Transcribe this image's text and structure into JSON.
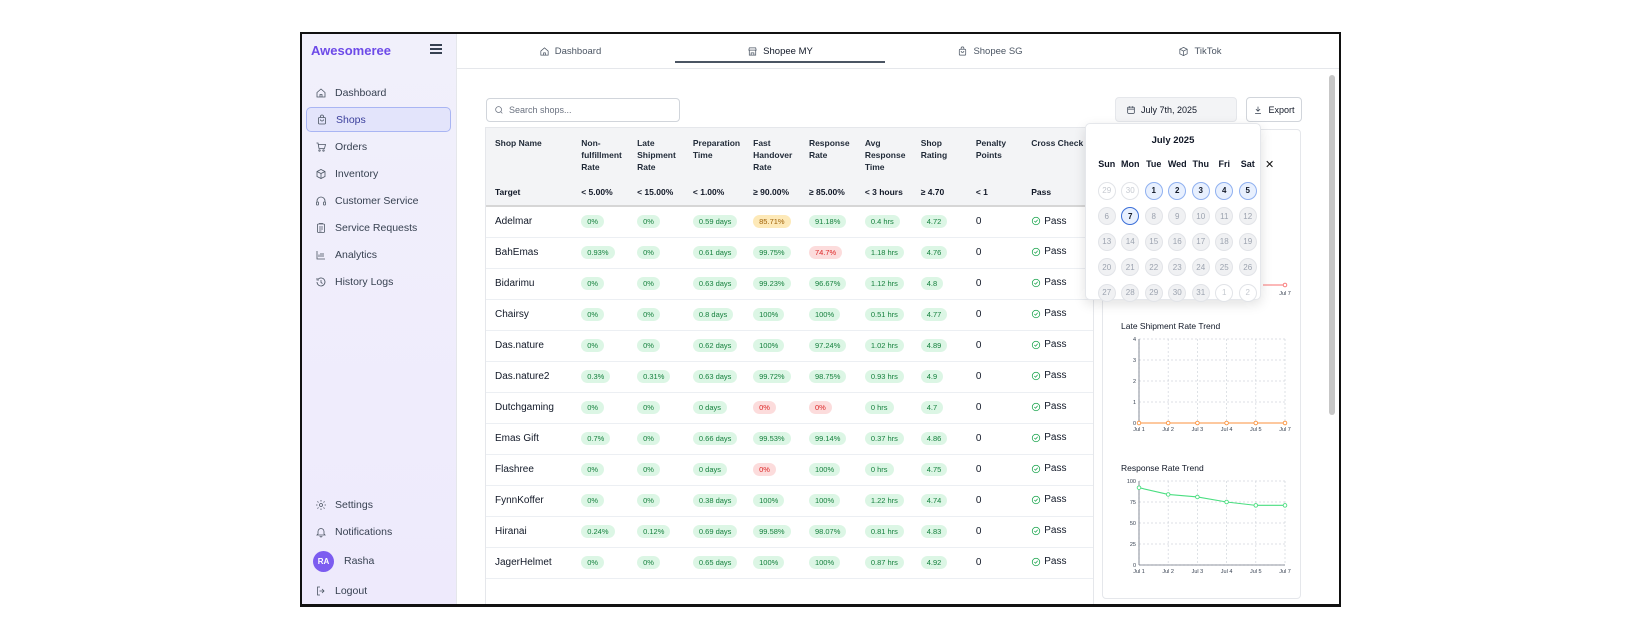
{
  "app": {
    "brand": "Awesomeree"
  },
  "sidebar": {
    "items": [
      {
        "label": "Dashboard",
        "icon": "home-icon"
      },
      {
        "label": "Shops",
        "icon": "shopping-bag-icon",
        "active": true
      },
      {
        "label": "Orders",
        "icon": "cart-icon"
      },
      {
        "label": "Inventory",
        "icon": "box-icon"
      },
      {
        "label": "Customer Service",
        "icon": "headset-icon"
      },
      {
        "label": "Service Requests",
        "icon": "clipboard-icon"
      },
      {
        "label": "Analytics",
        "icon": "bar-chart-icon"
      },
      {
        "label": "History Logs",
        "icon": "history-icon"
      }
    ],
    "bottom": {
      "settings": "Settings",
      "notifications": "Notifications",
      "user_initials": "RA",
      "user_name": "Rasha",
      "logout": "Logout"
    }
  },
  "tabs": [
    {
      "label": "Dashboard",
      "icon": "home-icon"
    },
    {
      "label": "Shopee MY",
      "icon": "store-icon",
      "active": true
    },
    {
      "label": "Shopee SG",
      "icon": "shopping-bag-icon"
    },
    {
      "label": "TikTok",
      "icon": "box-icon"
    }
  ],
  "toolbar": {
    "search_placeholder": "Search shops...",
    "date": "July 7th, 2025",
    "export": "Export"
  },
  "table": {
    "headers": [
      "Shop Name",
      "Non-fulfillment Rate",
      "Late Shipment Rate",
      "Preparation Time",
      "Fast Handover Rate",
      "Response Rate",
      "Avg Response Time",
      "Shop Rating",
      "Penalty Points",
      "Cross Check"
    ],
    "target": [
      "Target",
      "< 5.00%",
      "< 15.00%",
      "< 1.00%",
      "≥ 90.00%",
      "≥ 85.00%",
      "< 3 hours",
      "≥ 4.70",
      "< 1",
      "Pass"
    ],
    "rows": [
      {
        "shop": "Adelmar",
        "nfr": "0%",
        "lsr": "0%",
        "prep": "0.59 days",
        "fhr": "85.71%",
        "rr": "91.18%",
        "art": "0.4 hrs",
        "rating": "4.72",
        "pen": "0",
        "cc": "Pass",
        "fhr_status": "warn"
      },
      {
        "shop": "BahEmas",
        "nfr": "0.93%",
        "lsr": "0%",
        "prep": "0.61 days",
        "fhr": "99.75%",
        "rr": "74.7%",
        "art": "1.18 hrs",
        "rating": "4.76",
        "pen": "0",
        "cc": "Pass",
        "rr_status": "bad"
      },
      {
        "shop": "Bidarimu",
        "nfr": "0%",
        "lsr": "0%",
        "prep": "0.63 days",
        "fhr": "99.23%",
        "rr": "96.67%",
        "art": "1.12 hrs",
        "rating": "4.8",
        "pen": "0",
        "cc": "Pass"
      },
      {
        "shop": "Chairsy",
        "nfr": "0%",
        "lsr": "0%",
        "prep": "0.8 days",
        "fhr": "100%",
        "rr": "100%",
        "art": "0.51 hrs",
        "rating": "4.77",
        "pen": "0",
        "cc": "Pass"
      },
      {
        "shop": "Das.nature",
        "nfr": "0%",
        "lsr": "0%",
        "prep": "0.62 days",
        "fhr": "100%",
        "rr": "97.24%",
        "art": "1.02 hrs",
        "rating": "4.89",
        "pen": "0",
        "cc": "Pass"
      },
      {
        "shop": "Das.nature2",
        "nfr": "0.3%",
        "lsr": "0.31%",
        "prep": "0.63 days",
        "fhr": "99.72%",
        "rr": "98.75%",
        "art": "0.93 hrs",
        "rating": "4.9",
        "pen": "0",
        "cc": "Pass"
      },
      {
        "shop": "Dutchgaming",
        "nfr": "0%",
        "lsr": "0%",
        "prep": "0 days",
        "fhr": "0%",
        "rr": "0%",
        "art": "0 hrs",
        "rating": "4.7",
        "pen": "0",
        "cc": "Pass",
        "fhr_status": "bad",
        "rr_status": "bad"
      },
      {
        "shop": "Emas Gift",
        "nfr": "0.7%",
        "lsr": "0%",
        "prep": "0.66 days",
        "fhr": "99.53%",
        "rr": "99.14%",
        "art": "0.37 hrs",
        "rating": "4.86",
        "pen": "0",
        "cc": "Pass"
      },
      {
        "shop": "Flashree",
        "nfr": "0%",
        "lsr": "0%",
        "prep": "0 days",
        "fhr": "0%",
        "rr": "100%",
        "art": "0 hrs",
        "rating": "4.75",
        "pen": "0",
        "cc": "Pass",
        "fhr_status": "bad"
      },
      {
        "shop": "FynnKoffer",
        "nfr": "0%",
        "lsr": "0%",
        "prep": "0.38 days",
        "fhr": "100%",
        "rr": "100%",
        "art": "1.22 hrs",
        "rating": "4.74",
        "pen": "0",
        "cc": "Pass"
      },
      {
        "shop": "Hiranai",
        "nfr": "0.24%",
        "lsr": "0.12%",
        "prep": "0.69 days",
        "fhr": "99.58%",
        "rr": "98.07%",
        "art": "0.81 hrs",
        "rating": "4.83",
        "pen": "0",
        "cc": "Pass"
      },
      {
        "shop": "JagerHelmet",
        "nfr": "0%",
        "lsr": "0%",
        "prep": "0.65 days",
        "fhr": "100%",
        "rr": "100%",
        "art": "0.87 hrs",
        "rating": "4.92",
        "pen": "0",
        "cc": "Pass"
      }
    ]
  },
  "calendar": {
    "title": "July 2025",
    "weekdays": [
      "Sun",
      "Mon",
      "Tue",
      "Wed",
      "Thu",
      "Fri",
      "Sat"
    ],
    "days": [
      {
        "d": "29",
        "s": "outside"
      },
      {
        "d": "30",
        "s": "outside"
      },
      {
        "d": "1",
        "s": "enabled"
      },
      {
        "d": "2",
        "s": "enabled"
      },
      {
        "d": "3",
        "s": "enabled"
      },
      {
        "d": "4",
        "s": "enabled"
      },
      {
        "d": "5",
        "s": "enabled"
      },
      {
        "d": "6",
        "s": "disabled"
      },
      {
        "d": "7",
        "s": "selected"
      },
      {
        "d": "8",
        "s": "disabled"
      },
      {
        "d": "9",
        "s": "disabled"
      },
      {
        "d": "10",
        "s": "disabled"
      },
      {
        "d": "11",
        "s": "disabled"
      },
      {
        "d": "12",
        "s": "disabled"
      },
      {
        "d": "13",
        "s": "disabled"
      },
      {
        "d": "14",
        "s": "disabled"
      },
      {
        "d": "15",
        "s": "disabled"
      },
      {
        "d": "16",
        "s": "disabled"
      },
      {
        "d": "17",
        "s": "disabled"
      },
      {
        "d": "18",
        "s": "disabled"
      },
      {
        "d": "19",
        "s": "disabled"
      },
      {
        "d": "20",
        "s": "disabled"
      },
      {
        "d": "21",
        "s": "disabled"
      },
      {
        "d": "22",
        "s": "disabled"
      },
      {
        "d": "23",
        "s": "disabled"
      },
      {
        "d": "24",
        "s": "disabled"
      },
      {
        "d": "25",
        "s": "disabled"
      },
      {
        "d": "26",
        "s": "disabled"
      },
      {
        "d": "27",
        "s": "disabled"
      },
      {
        "d": "28",
        "s": "disabled"
      },
      {
        "d": "29",
        "s": "disabled"
      },
      {
        "d": "30",
        "s": "disabled"
      },
      {
        "d": "31",
        "s": "disabled"
      },
      {
        "d": "1",
        "s": "outside"
      },
      {
        "d": "2",
        "s": "outside"
      }
    ]
  },
  "chart_data": [
    {
      "type": "line",
      "title": "",
      "partially_hidden": true,
      "x": [
        "Jul 7"
      ],
      "series": [
        {
          "values": [
            0
          ],
          "color": "#f87171"
        }
      ]
    },
    {
      "type": "line",
      "title": "Late Shipment Rate Trend",
      "x": [
        "Jul 1",
        "Jul 2",
        "Jul 3",
        "Jul 4",
        "Jul 5",
        "Jul 7"
      ],
      "ylim": [
        0,
        4
      ],
      "yticks": [
        "0",
        "1",
        "2",
        "3",
        "4"
      ],
      "grid": true,
      "series": [
        {
          "values": [
            0,
            0,
            0,
            0,
            0,
            0
          ],
          "color": "#fb923c"
        }
      ]
    },
    {
      "type": "line",
      "title": "Response Rate Trend",
      "x": [
        "Jul 1",
        "Jul 2",
        "Jul 3",
        "Jul 4",
        "Jul 5",
        "Jul 7"
      ],
      "ylim": [
        0,
        100
      ],
      "yticks": [
        "0",
        "25",
        "50",
        "75",
        "100"
      ],
      "grid": true,
      "series": [
        {
          "values": [
            92,
            84,
            81,
            75,
            71,
            71
          ],
          "color": "#4ade80"
        }
      ]
    }
  ],
  "colors": {
    "accent": "#6d4ae8",
    "pass": "#16a34a",
    "fab": "#f97316"
  }
}
